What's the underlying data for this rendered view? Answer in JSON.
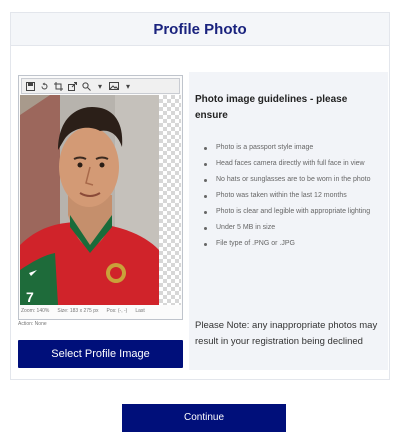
{
  "header": {
    "title": "Profile Photo"
  },
  "editor": {
    "toolbar_icons": [
      "save-icon",
      "rotate-icon",
      "crop-icon",
      "resize-icon",
      "zoom-icon",
      "dropdown-arrow",
      "image-icon",
      "dropdown-arrow"
    ],
    "status": {
      "zoom": "Zoom: 140%",
      "size": "Size: 183 x 275 px",
      "pos": "Pos: (-, -)",
      "last": "Last"
    },
    "action": "Action: None"
  },
  "select_button": {
    "label": "Select Profile Image"
  },
  "guidelines": {
    "title": "Photo image guidelines - please ensure",
    "items": [
      "Photo is a passport style image",
      "Head faces camera directly with full face in view",
      "No hats or sunglasses are to be worn in the photo",
      "Photo was taken within the last 12 months",
      "Photo is clear and legible with appropriate lighting",
      "Under 5 MB in size",
      "File type of .PNG or .JPG"
    ],
    "note": "Please Note: any inappropriate photos may result in your registration being declined"
  },
  "continue_button": {
    "label": "Continue"
  },
  "colors": {
    "accent": "#000f7a",
    "title": "#1a237e",
    "panel": "#f2f4f8"
  }
}
